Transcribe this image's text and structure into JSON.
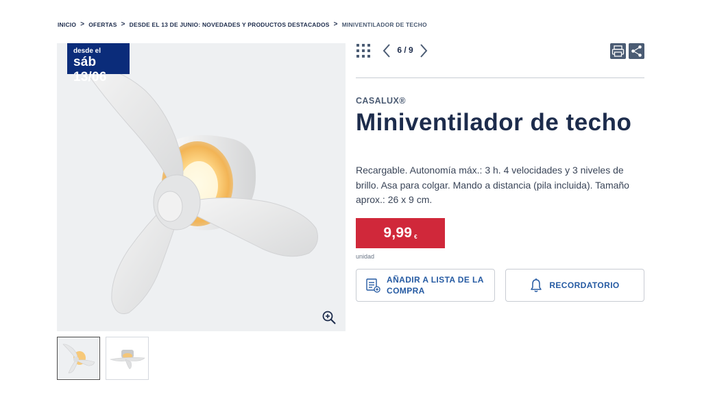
{
  "breadcrumb": {
    "items": [
      "INICIO",
      "OFERTAS",
      "DESDE EL 13 DE JUNIO: NOVEDADES Y PRODUCTOS DESTACADOS"
    ],
    "current": "MINIVENTILADOR DE TECHO",
    "separator": ">"
  },
  "badge": {
    "line1": "desde el",
    "line2": "sáb 13/06",
    "color": "#0b2c7a"
  },
  "gallery": {
    "current": "6",
    "total": "9",
    "pager_text": "6 / 9",
    "thumbnails": [
      "fan-front-view",
      "fan-side-view"
    ],
    "selected_thumbnail": 0
  },
  "icons": {
    "grid": "grid-icon",
    "prev": "chevron-left-icon",
    "next": "chevron-right-icon",
    "print": "printer-icon",
    "share": "share-icon",
    "zoom": "zoom-in-icon",
    "list": "shopping-list-icon",
    "bell": "bell-icon"
  },
  "product": {
    "brand": "CASALUX®",
    "title": "Miniventilador de techo",
    "description": "Recargable. Autonomía máx.: 3 h. 4 velocidades y 3 niveles de brillo. Asa para colgar. Mando a distancia (pila incluida). Tamaño aprox.: 26 x 9 cm.",
    "price": "9,99",
    "currency": "€",
    "unit": "unidad"
  },
  "actions": {
    "add_to_list": "AÑADIR A LISTA DE LA COMPRA",
    "reminder": "RECORDATORIO"
  },
  "colors": {
    "navy": "#1d2c4c",
    "badge_blue": "#0b2c7a",
    "price_red": "#d0283a",
    "link_blue": "#255aa2",
    "icon_gray": "#4b5c74"
  }
}
